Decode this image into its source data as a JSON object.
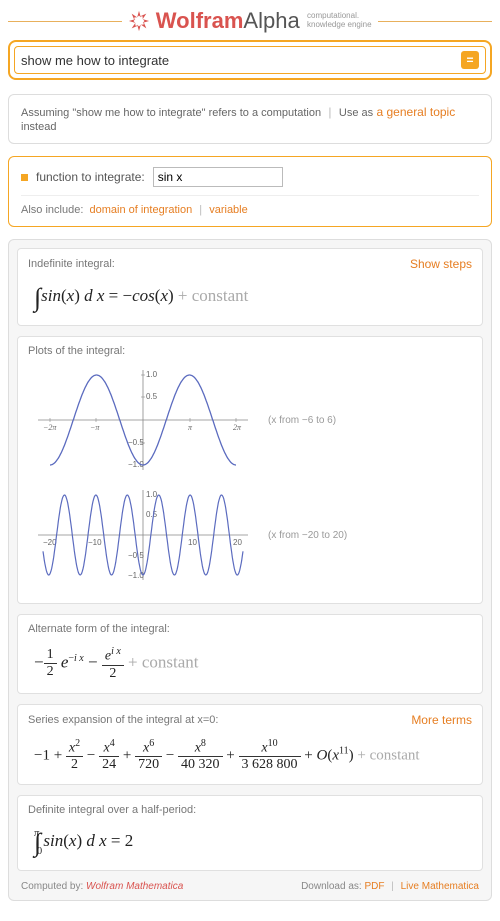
{
  "logo": {
    "word1": "Wolfram",
    "word2": "Alpha",
    "tagline1": "computational.",
    "tagline2": "knowledge engine"
  },
  "search": {
    "value": "show me how to integrate",
    "button": "="
  },
  "assumption": {
    "prefix": "Assuming \"show me how to integrate\" refers to a computation",
    "use_as": "Use as",
    "alt": "a general topic",
    "suffix": "instead"
  },
  "func": {
    "label": "function to integrate:",
    "value": "sin x",
    "also": "Also include:",
    "opt1": "domain of integration",
    "opt2": "variable"
  },
  "cards": {
    "indef": {
      "title": "Indefinite integral:",
      "show_steps": "Show steps",
      "formula_lhs": "sin(x) d x = −cos(x)",
      "const": "+ constant"
    },
    "plots": {
      "title": "Plots of the integral:",
      "cap1": "(x from −6 to 6)",
      "cap2": "(x from −20 to 20)"
    },
    "alt": {
      "title": "Alternate form of the integral:",
      "const": "+ constant"
    },
    "series": {
      "title": "Series expansion of the integral at x=0:",
      "more": "More terms",
      "const": "+ constant"
    },
    "definite": {
      "title": "Definite integral over a half-period:",
      "formula": "sin(x) d x = 2"
    }
  },
  "chart_data": [
    {
      "type": "line",
      "title": "",
      "xlabel": "",
      "ylabel": "",
      "xlim": [
        -6.283,
        6.283
      ],
      "ylim": [
        -1.0,
        1.0
      ],
      "xticks_labels": [
        "−2π",
        "−π",
        "π",
        "2π"
      ],
      "yticks": [
        -1.0,
        -0.5,
        0.5,
        1.0
      ],
      "series": [
        {
          "name": "-cos(x)",
          "function": "-cos(x)"
        }
      ]
    },
    {
      "type": "line",
      "title": "",
      "xlabel": "",
      "ylabel": "",
      "xlim": [
        -20,
        20
      ],
      "ylim": [
        -1.0,
        1.0
      ],
      "xticks": [
        -20,
        -10,
        10,
        20
      ],
      "yticks": [
        -1.0,
        -0.5,
        0.5,
        1.0
      ],
      "series": [
        {
          "name": "-cos(x)",
          "function": "-cos(x)"
        }
      ]
    }
  ],
  "footer": {
    "computed": "Computed by:",
    "wolfram": "Wolfram",
    "mathematica": "Mathematica",
    "download": "Download as:",
    "pdf": "PDF",
    "live": "Live Mathematica"
  }
}
